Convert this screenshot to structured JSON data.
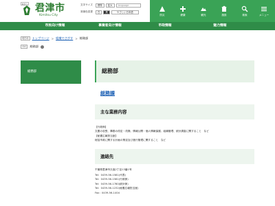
{
  "header": {
    "skip_label": "本文へ",
    "logo_title": "君津市",
    "logo_sub": "Kimitsu City",
    "font_size_label": "文字サイズ",
    "font_standard": "標準",
    "font_large": "拡大",
    "language_label": "language",
    "bg_color_label": "背景色変更",
    "bg_white": "白",
    "bg_black": "黒",
    "easy_japanese": "やさしい日本語",
    "quick_links": [
      {
        "label": "防災",
        "icon": "disaster-icon"
      },
      {
        "label": "健康",
        "icon": "health-icon"
      },
      {
        "label": "観光",
        "icon": "sightseeing-icon"
      },
      {
        "label": "施設",
        "icon": "facility-icon"
      },
      {
        "label": "検索",
        "icon": "search-icon"
      },
      {
        "label": "メニュー",
        "icon": "menu-icon"
      }
    ]
  },
  "nav": {
    "items": [
      "市民向け情報",
      "事業者向け情報",
      "市政情報",
      "魅力情報"
    ]
  },
  "breadcrumb": {
    "tag": "現在地",
    "home": "トップページ",
    "parent": "組織でさがす",
    "current": "総務部",
    "row2_tag": "SNS",
    "row2_text": "総務部"
  },
  "sidebar": {
    "title": "総務部"
  },
  "main": {
    "title": "総務部",
    "section_link": "総務課",
    "duties_heading": "主な業務内容",
    "duties": [
      "【行政係】",
      "文書の収受、事務の改定・改廃、情報公開・個人情報保護、組織管理、統計調査に関すること　など",
      "【秘書広報担当室】",
      "総括市政に関する計画の策定及び進行管理に関すること　など"
    ],
    "contact_heading": "連絡先",
    "contact": [
      "千葉県君津市久保2丁目13番1号",
      "Tel：0439-56-1581(代表)",
      "Tel：0439-56-1581(行政係)",
      "Tel：0439-56-1780(統計係)",
      "Tel：0439-56-1232(秘書広報担当室)",
      "Fax：0439-56-1404"
    ]
  },
  "colors": {
    "brand_green": "#2f8c48",
    "header_green": "#3aa356",
    "link_blue": "#1a5fb4"
  }
}
